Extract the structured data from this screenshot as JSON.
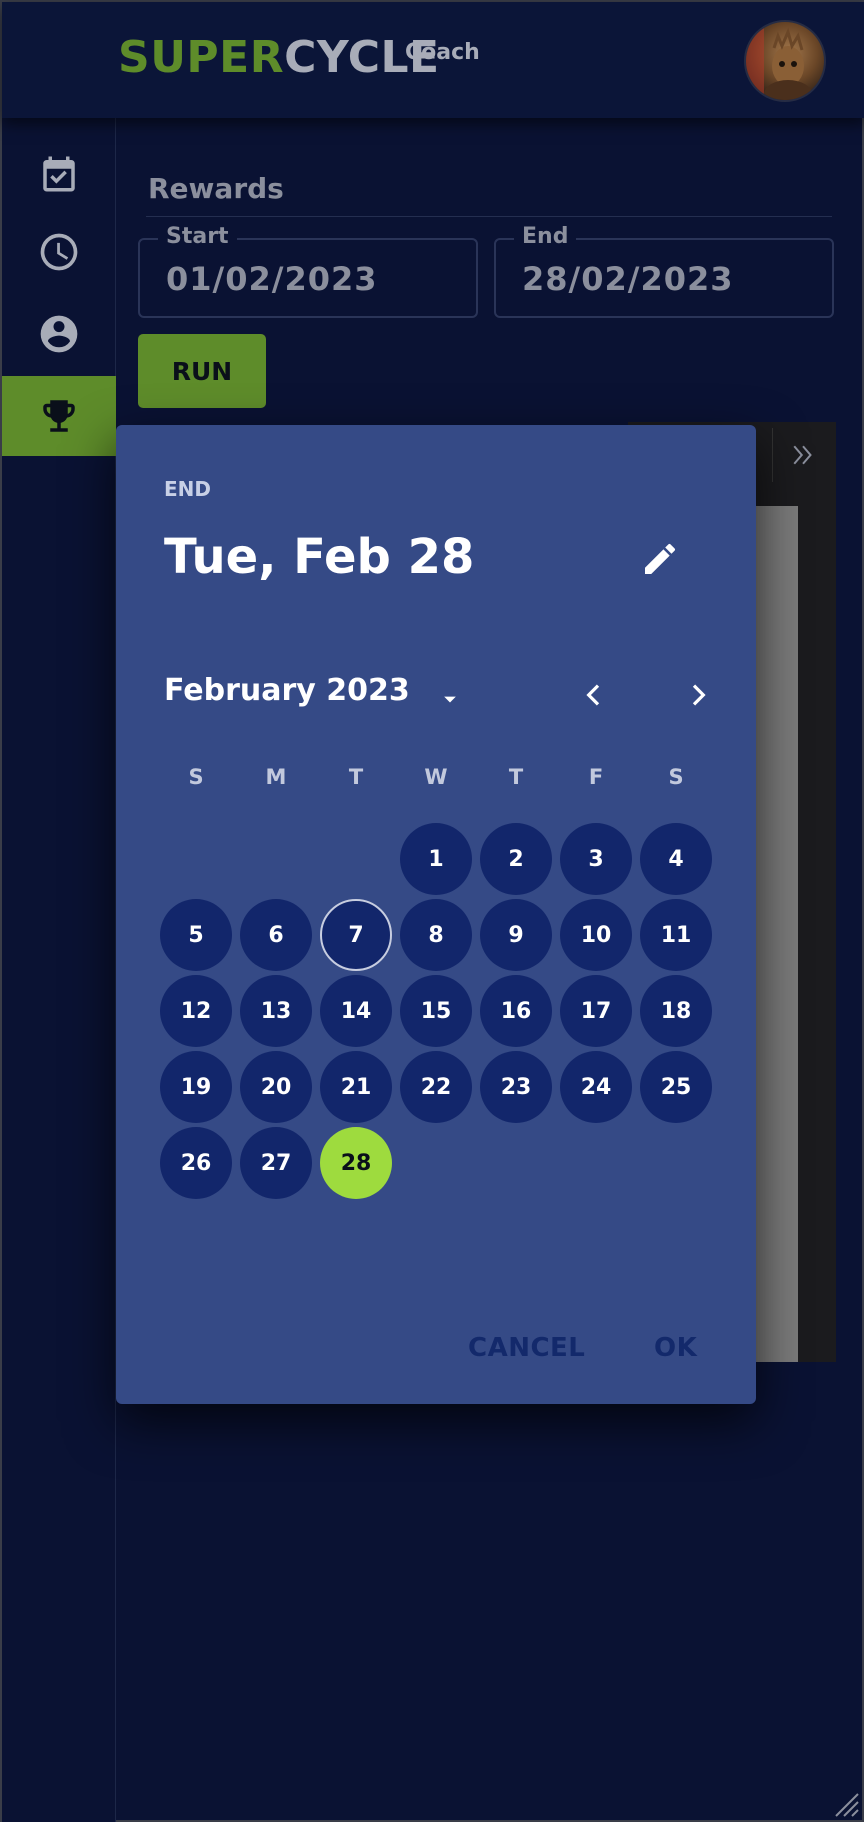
{
  "app": {
    "logo_part1": "SUPER",
    "logo_part2": "CYCLE",
    "logo_sub": "Coach"
  },
  "sidebar": {
    "items": [
      {
        "icon": "calendar-check-icon",
        "active": false
      },
      {
        "icon": "clock-icon",
        "active": false
      },
      {
        "icon": "account-circle-icon",
        "active": false
      },
      {
        "icon": "trophy-icon",
        "active": true
      }
    ]
  },
  "page": {
    "title": "Rewards",
    "start_label": "Start",
    "start_value": "01/02/2023",
    "end_label": "End",
    "end_value": "28/02/2023",
    "run_label": "RUN"
  },
  "date_picker": {
    "overline": "END",
    "selected_date_text": "Tue, Feb 28",
    "month_year": "February 2023",
    "weekdays": [
      "S",
      "M",
      "T",
      "W",
      "T",
      "F",
      "S"
    ],
    "first_weekday_index": 3,
    "days": [
      "1",
      "2",
      "3",
      "4",
      "5",
      "6",
      "7",
      "8",
      "9",
      "10",
      "11",
      "12",
      "13",
      "14",
      "15",
      "16",
      "17",
      "18",
      "19",
      "20",
      "21",
      "22",
      "23",
      "24",
      "25",
      "26",
      "27",
      "28"
    ],
    "today": "7",
    "selected": "28",
    "cancel_label": "CANCEL",
    "ok_label": "OK"
  },
  "colors": {
    "brand_green": "#5e8c2a",
    "selected_day": "#9edb3e",
    "dialog_bg": "#354a86",
    "day_bg": "#12266b"
  }
}
